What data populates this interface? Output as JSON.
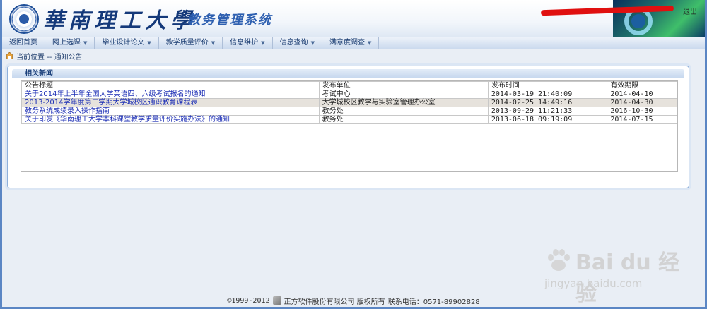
{
  "header": {
    "university_name": "華南理工大學",
    "system_name": "教务管理系统",
    "logout_label": "退出"
  },
  "nav": {
    "items": [
      {
        "label": "返回首页",
        "has_menu": false
      },
      {
        "label": "网上选课",
        "has_menu": true
      },
      {
        "label": "毕业设计论文",
        "has_menu": true
      },
      {
        "label": "教学质量评价",
        "has_menu": true
      },
      {
        "label": "信息维护",
        "has_menu": true
      },
      {
        "label": "信息查询",
        "has_menu": true
      },
      {
        "label": "满意度调查",
        "has_menu": true
      }
    ]
  },
  "breadcrumb": {
    "text": "当前位置 -- 通知公告"
  },
  "panel": {
    "title": "相关新闻",
    "columns": [
      "公告标题",
      "发布单位",
      "发布时间",
      "有效期限"
    ],
    "rows": [
      {
        "title": "关于2014年上半年全国大学英语四、六级考试报名的通知",
        "unit": "考试中心",
        "time": "2014-03-19 21:40:09",
        "expiry": "2014-04-10"
      },
      {
        "title": "2013-2014学年度第二学期大学城校区通识教育课程表",
        "unit": "大学城校区教学与实验室管理办公室",
        "time": "2014-02-25 14:49:16",
        "expiry": "2014-04-30"
      },
      {
        "title": "教务系统成绩录入操作指南",
        "unit": "教务处",
        "time": "2013-09-29 11:21:33",
        "expiry": "2016-10-30"
      },
      {
        "title": "关于印发《华南理工大学本科课堂教学质量评价实施办法》的通知",
        "unit": "教务处",
        "time": "2013-06-18 09:19:09",
        "expiry": "2014-07-15"
      }
    ]
  },
  "footer": {
    "copyright": "©1999-2012",
    "company": "正方软件股份有限公司 版权所有",
    "phone": "联系电话：0571-89902828"
  },
  "watermark": {
    "brand": "Bai du 经验",
    "url": "jingyan.baidu.com"
  }
}
